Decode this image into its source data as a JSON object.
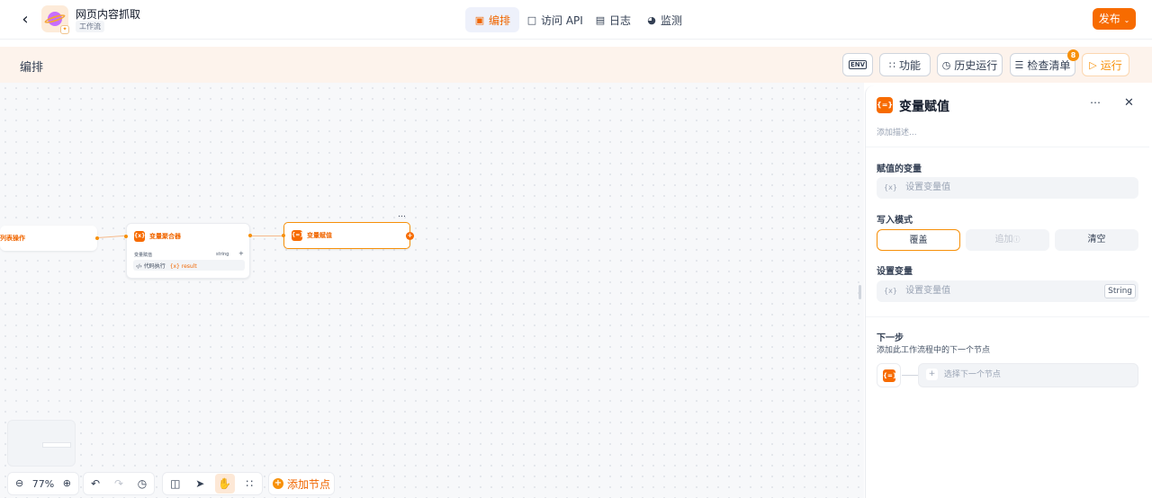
{
  "header": {
    "app_title": "网页内容抓取",
    "app_tag": "工作流",
    "nav": [
      {
        "icon": "layout-icon",
        "label": "编排",
        "active": true
      },
      {
        "icon": "terminal-icon",
        "label": "访问 API"
      },
      {
        "icon": "log-icon",
        "label": "日志"
      },
      {
        "icon": "monitor-icon",
        "label": "监测"
      }
    ],
    "publish_label": "发布"
  },
  "toolbar": {
    "title": "编排",
    "env_label": "ENV",
    "features_label": "功能",
    "history_label": "历史运行",
    "checklist_label": "检查清单",
    "checklist_count": "8",
    "run_label": "运行"
  },
  "canvas": {
    "nodes": {
      "left_label": "列表操作",
      "aggregator": {
        "title": "变量聚合器",
        "sub_label": "变量赋值",
        "type": "string",
        "row_source": "代码执行",
        "row_var": "{x} result"
      },
      "assign": {
        "title": "变量赋值"
      }
    },
    "zoom_level": "77%",
    "add_node_label": "添加节点"
  },
  "panel": {
    "title": "变量赋值",
    "desc_placeholder": "添加描述...",
    "assigned_var_label": "赋值的变量",
    "var_placeholder": "设置变量值",
    "write_mode_label": "写入模式",
    "modes": [
      "覆盖",
      "追加",
      "清空"
    ],
    "set_var_label": "设置变量",
    "set_var_placeholder": "设置变量值",
    "set_var_type": "String",
    "next_title": "下一步",
    "next_desc": "添加此工作流程中的下一个节点",
    "next_select": "选择下一个节点"
  },
  "colors": {
    "accent": "#f76b00",
    "highlight_bg": "#fdf3ec"
  }
}
